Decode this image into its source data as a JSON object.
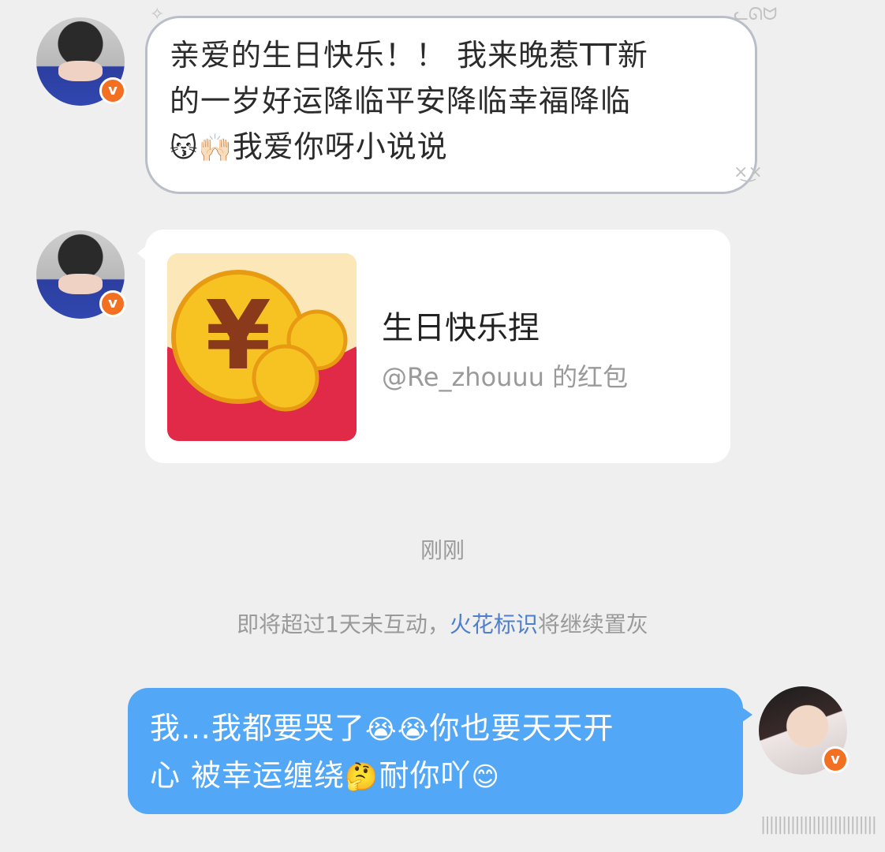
{
  "messages": {
    "first": {
      "lines": [
        "亲爱的生日快乐！！ 我来晚惹TT新",
        "的一岁好运降临平安降临幸福降临",
        "我爱你呀小说说"
      ],
      "emojis": [
        "😽",
        "🙌🏻"
      ]
    },
    "red_packet": {
      "title": "生日快乐捏",
      "subtitle": "@Re_zhouuu 的红包",
      "currency_symbol": "¥"
    },
    "timestamp": "刚刚",
    "notice": {
      "before": "即将超过1天未互动，",
      "link": "火花标识",
      "after": "将继续置灰"
    },
    "reply": {
      "line1": "我…我都要哭了",
      "line1_after": "你也要天天开",
      "line2": "心 被幸运缠绕",
      "line2_after": "耐你吖",
      "emojis": [
        "😭",
        "😭",
        "🤔",
        "😊"
      ]
    }
  },
  "badge_letter": "v",
  "watermark": "|||||||||||||||||||||||||||",
  "colors": {
    "bubble_blue": "#52a7f6",
    "badge_orange": "#f36f21",
    "link_blue": "#4f7fcb",
    "envelope_red": "#e02a48",
    "coin_gold": "#f7c322"
  }
}
